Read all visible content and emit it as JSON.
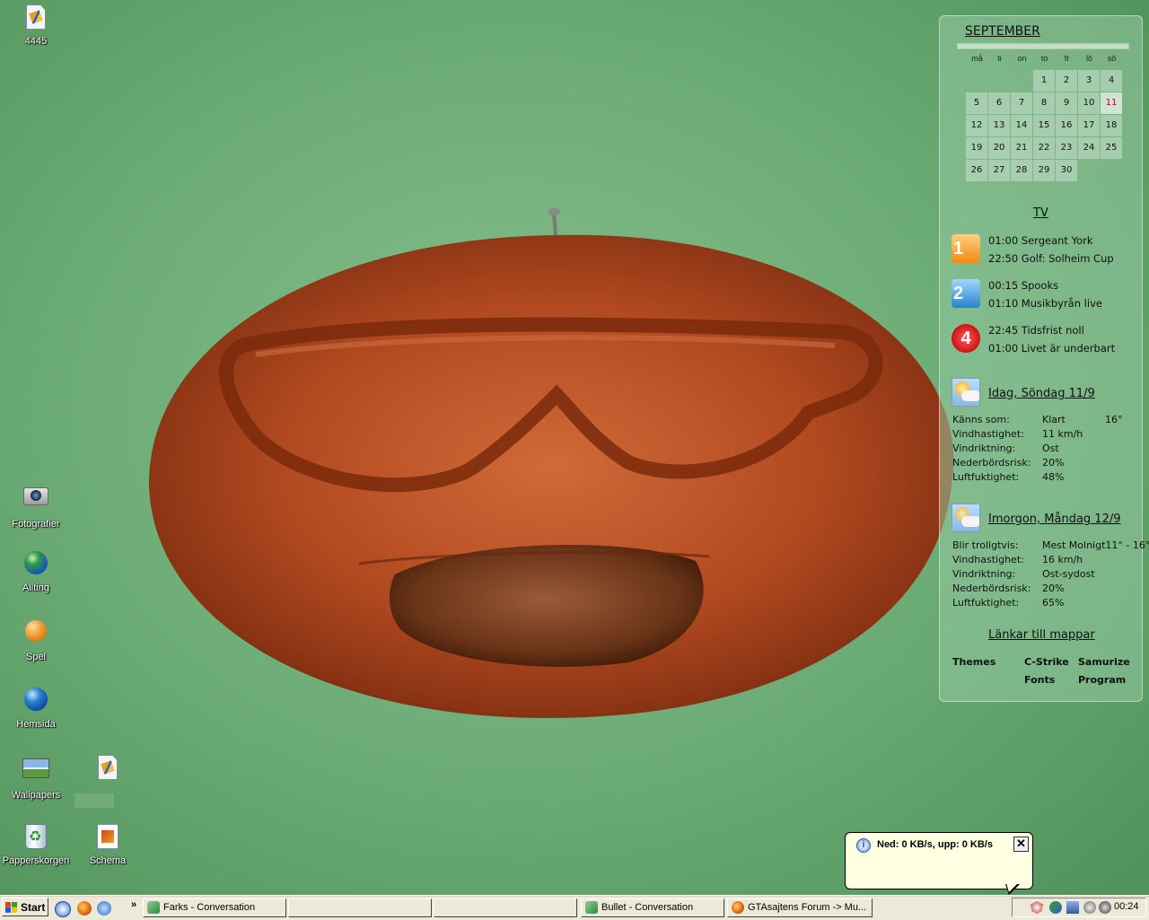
{
  "desktop": {
    "icons": [
      {
        "label": "4445"
      },
      {
        "label": "Fotografier"
      },
      {
        "label": "Allting"
      },
      {
        "label": "Spel"
      },
      {
        "label": "Hemsida"
      },
      {
        "label": "Wallpapers"
      },
      {
        "label": "Papperskorgen"
      },
      {
        "label": "Schema"
      }
    ]
  },
  "panel": {
    "calendar": {
      "month": "SEPTEMBER",
      "weekdays": [
        "må",
        "ti",
        "on",
        "to",
        "fr",
        "lö",
        "sö"
      ],
      "days": [
        "1",
        "2",
        "3",
        "4",
        "5",
        "6",
        "7",
        "8",
        "9",
        "10",
        "11",
        "12",
        "13",
        "14",
        "15",
        "16",
        "17",
        "18",
        "19",
        "20",
        "21",
        "22",
        "23",
        "24",
        "25",
        "26",
        "27",
        "28",
        "29",
        "30"
      ],
      "today": "11"
    },
    "tv": {
      "title": "TV",
      "channels": [
        {
          "icon": "1",
          "programs": [
            "01:00 Sergeant York",
            "22:50 Golf: Solheim Cup"
          ]
        },
        {
          "icon": "2",
          "programs": [
            "00:15 Spooks",
            "01:10 Musikbyrån live"
          ]
        },
        {
          "icon": "4",
          "programs": [
            "22:45 Tidsfrist noll",
            "01:00 Livet är underbart"
          ]
        }
      ]
    },
    "weather_today": {
      "title": "Idag, Söndag 11/9",
      "rows": [
        {
          "label": "Känns som:",
          "value": "Klart",
          "temp": "16°"
        },
        {
          "label": "Vindhastighet:",
          "value": "11 km/h"
        },
        {
          "label": "Vindriktning:",
          "value": "Ost"
        },
        {
          "label": "Nederbördsrisk:",
          "value": "20%"
        },
        {
          "label": "Luftfuktighet:",
          "value": "48%"
        }
      ]
    },
    "weather_tomorrow": {
      "title": "Imorgon, Måndag 12/9",
      "rows": [
        {
          "label": "Blir troligtvis:",
          "value": "Mest Molnigt11° - 16°"
        },
        {
          "label": "Vindhastighet:",
          "value": "16 km/h"
        },
        {
          "label": "Vindriktning:",
          "value": "Ost-sydost"
        },
        {
          "label": "Nederbördsrisk:",
          "value": "20%"
        },
        {
          "label": "Luftfuktighet:",
          "value": "65%"
        }
      ]
    },
    "links": {
      "title": "Länkar till mappar",
      "items": [
        "Themes",
        "C-Strike",
        "Samurize",
        "Fonts",
        "Program"
      ]
    }
  },
  "balloon": {
    "text": "Ned: 0 KB/s, upp: 0 KB/s",
    "close": "✕"
  },
  "taskbar": {
    "start_label": "Start",
    "chevron": "»",
    "buttons": [
      "Farks - Conversation",
      "",
      "",
      "Bullet - Conversation",
      "GTAsajtens Forum -> Mu..."
    ],
    "clock": "00:24"
  },
  "colors": {
    "desktop": "#6fae78",
    "mask_wood": "#b24a20",
    "panel": "#96c8a0",
    "taskbar": "#ece9d8",
    "balloon": "#ffffe1"
  }
}
